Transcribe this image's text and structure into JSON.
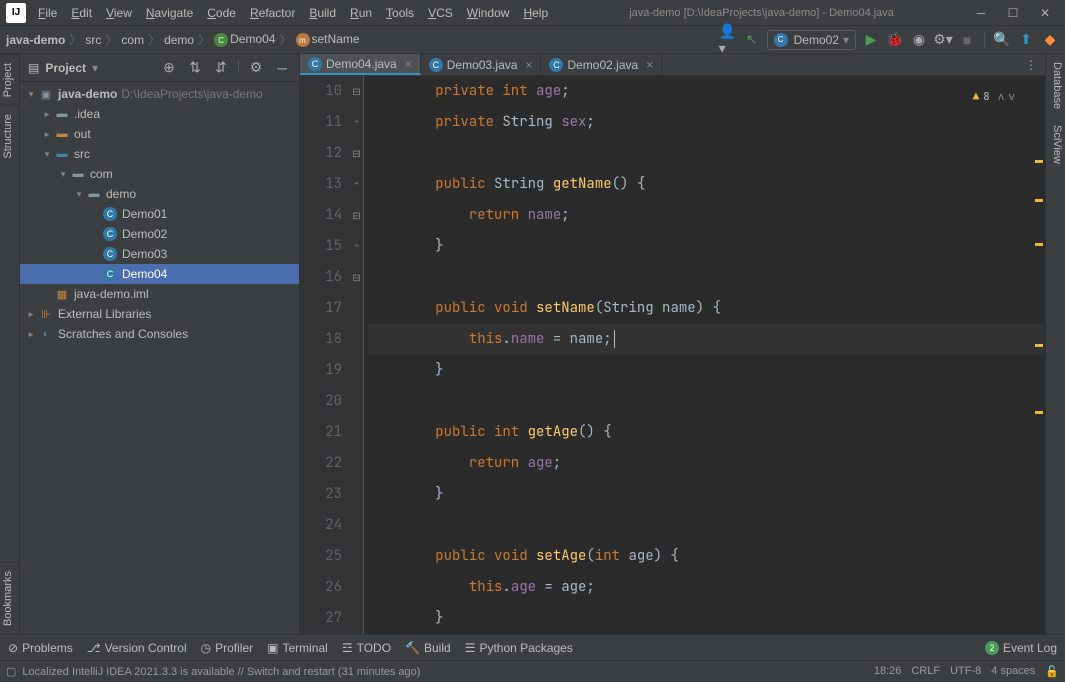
{
  "window": {
    "title": "java-demo [D:\\IdeaProjects\\java-demo] - Demo04.java"
  },
  "menu": [
    "File",
    "Edit",
    "View",
    "Navigate",
    "Code",
    "Refactor",
    "Build",
    "Run",
    "Tools",
    "VCS",
    "Window",
    "Help"
  ],
  "breadcrumb": {
    "items": [
      "java-demo",
      "src",
      "com",
      "demo",
      "Demo04",
      "setName"
    ]
  },
  "run_config": "Demo02",
  "sidebar": {
    "title": "Project",
    "project_name": "java-demo",
    "project_path": "D:\\IdeaProjects\\java-demo",
    "tree": {
      "idea": ".idea",
      "out": "out",
      "src": "src",
      "com": "com",
      "demo": "demo",
      "demo01": "Demo01",
      "demo02": "Demo02",
      "demo03": "Demo03",
      "demo04": "Demo04",
      "iml": "java-demo.iml",
      "ext_lib": "External Libraries",
      "scratches": "Scratches and Consoles"
    }
  },
  "tabs": [
    {
      "name": "Demo04.java",
      "active": true
    },
    {
      "name": "Demo03.java",
      "active": false
    },
    {
      "name": "Demo02.java",
      "active": false
    }
  ],
  "editor": {
    "warn_count": "8",
    "lines": [
      {
        "n": 10,
        "indent": 2,
        "tokens": [
          [
            "kw",
            "private "
          ],
          [
            "kw",
            "int "
          ],
          [
            "field",
            "age"
          ],
          [
            "",
            ";"
          ]
        ]
      },
      {
        "n": 11,
        "indent": 2,
        "tokens": [
          [
            "kw",
            "private "
          ],
          [
            "type",
            "String "
          ],
          [
            "field",
            "sex"
          ],
          [
            "",
            ";"
          ]
        ]
      },
      {
        "n": 12,
        "indent": 0,
        "tokens": []
      },
      {
        "n": 13,
        "indent": 2,
        "fold": "-",
        "tokens": [
          [
            "kw",
            "public "
          ],
          [
            "type",
            "String "
          ],
          [
            "method",
            "getName"
          ],
          [
            "",
            "() {"
          ]
        ]
      },
      {
        "n": 14,
        "indent": 3,
        "tokens": [
          [
            "kw",
            "return "
          ],
          [
            "field",
            "name"
          ],
          [
            "",
            ";"
          ]
        ]
      },
      {
        "n": 15,
        "indent": 2,
        "fold": "^",
        "tokens": [
          [
            "",
            "}"
          ]
        ]
      },
      {
        "n": 16,
        "indent": 0,
        "tokens": []
      },
      {
        "n": 17,
        "indent": 2,
        "fold": "-",
        "tokens": [
          [
            "kw",
            "public "
          ],
          [
            "kw",
            "void "
          ],
          [
            "method",
            "setName"
          ],
          [
            "",
            "("
          ],
          [
            "type",
            "String "
          ],
          [
            "",
            "name) {"
          ]
        ]
      },
      {
        "n": 18,
        "indent": 3,
        "caret": true,
        "tokens": [
          [
            "this",
            "this"
          ],
          [
            "",
            "."
          ],
          [
            "field",
            "name"
          ],
          [
            "",
            " = name;"
          ]
        ]
      },
      {
        "n": 19,
        "indent": 2,
        "fold": "^",
        "tokens": [
          [
            "",
            "}"
          ]
        ]
      },
      {
        "n": 20,
        "indent": 0,
        "tokens": []
      },
      {
        "n": 21,
        "indent": 2,
        "fold": "-",
        "tokens": [
          [
            "kw",
            "public "
          ],
          [
            "kw",
            "int "
          ],
          [
            "method",
            "getAge"
          ],
          [
            "",
            "() {"
          ]
        ]
      },
      {
        "n": 22,
        "indent": 3,
        "tokens": [
          [
            "kw",
            "return "
          ],
          [
            "field",
            "age"
          ],
          [
            "",
            ";"
          ]
        ]
      },
      {
        "n": 23,
        "indent": 2,
        "fold": "^",
        "tokens": [
          [
            "",
            "}"
          ]
        ]
      },
      {
        "n": 24,
        "indent": 0,
        "tokens": []
      },
      {
        "n": 25,
        "indent": 2,
        "fold": "-",
        "tokens": [
          [
            "kw",
            "public "
          ],
          [
            "kw",
            "void "
          ],
          [
            "method",
            "setAge"
          ],
          [
            "",
            "("
          ],
          [
            "kw",
            "int "
          ],
          [
            "",
            "age) {"
          ]
        ]
      },
      {
        "n": 26,
        "indent": 3,
        "tokens": [
          [
            "this",
            "this"
          ],
          [
            "",
            "."
          ],
          [
            "field",
            "age"
          ],
          [
            "",
            " = age;"
          ]
        ]
      },
      {
        "n": 27,
        "indent": 2,
        "tokens": [
          [
            "",
            "}"
          ]
        ]
      }
    ]
  },
  "gutters": {
    "left": [
      "Project",
      "Structure",
      "Bookmarks"
    ],
    "right": [
      "Database",
      "SciView"
    ]
  },
  "toolwindows": {
    "problems": "Problems",
    "vcs": "Version Control",
    "profiler": "Profiler",
    "terminal": "Terminal",
    "todo": "TODO",
    "build": "Build",
    "python": "Python Packages",
    "eventlog": "Event Log",
    "event_count": "2"
  },
  "statusbar": {
    "msg": "Localized IntelliJ IDEA 2021.3.3 is available // Switch and restart (31 minutes ago)",
    "pos": "18:26",
    "line_sep": "CRLF",
    "encoding": "UTF-8",
    "indent": "4 spaces"
  }
}
